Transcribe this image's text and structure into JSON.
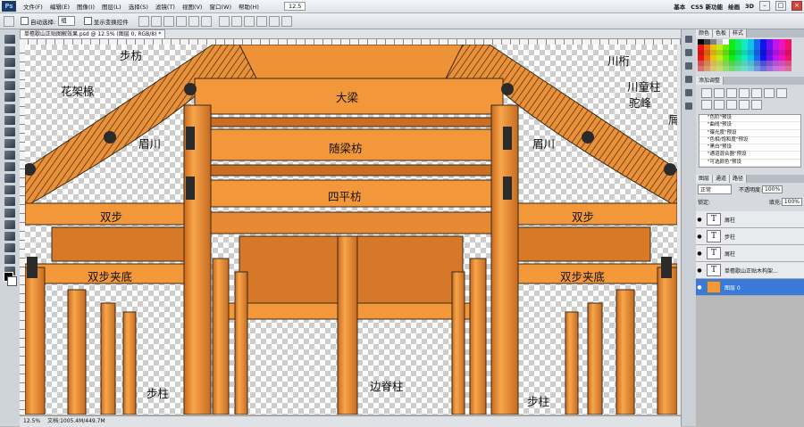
{
  "app": {
    "logo": "Ps"
  },
  "menu": [
    "文件(F)",
    "编辑(E)",
    "图像(I)",
    "图层(L)",
    "选择(S)",
    "滤镜(T)",
    "视图(V)",
    "窗口(W)",
    "帮助(H)"
  ],
  "menu_right": {
    "zoom": "12.5",
    "workspace1": "基本",
    "workspace2": "CS5 新功能",
    "workspace3": "绘画",
    "workspace4": "3D"
  },
  "options": {
    "auto_select_label": "自动选择:",
    "auto_select_value": "组",
    "show_transform_label": "显示变换控件"
  },
  "document": {
    "tab_title": "单檐歇山正贴图解效果.psd @ 12.5% (图层 0, RGB/8) *"
  },
  "canvas_labels": {
    "bufang": "步枋",
    "huajiachuan": "花架椽",
    "chuanheng": "川桁",
    "chuantongzhu": "川童柱",
    "tuofeng": "驼峰",
    "dali": "大梁",
    "meichuan_l": "眉川",
    "meichuan_r": "眉川",
    "suiliangfang": "随梁枋",
    "sipingfang": "四平枋",
    "shuangbu_l": "双步",
    "shuangbu_r": "双步",
    "shuangbujiadi_l": "双步夹底",
    "shuangbujiadi_r": "双步夹底",
    "buzhu_l": "步柱",
    "bianjizhu": "边脊柱",
    "buzhu_r": "步柱",
    "edge_mark": "屑"
  },
  "status": {
    "zoom": "12.5%",
    "doc": "文档:1005.4M/449.7M"
  },
  "panels": {
    "swatches_tabs": [
      "颜色",
      "色板",
      "样式"
    ],
    "adjust_title": "添加调整",
    "presets": [
      "\"色阶\"预设",
      "\"曲线\"预设",
      "\"曝光度\"预设",
      "\"色相/饱和度\"预设",
      "\"黑白\"预设",
      "\"通道混合器\"预设",
      "\"可选颜色\"预设"
    ],
    "layers_tabs": [
      "图层",
      "通道",
      "路径"
    ],
    "blend_mode": "正常",
    "opacity_label": "不透明度:",
    "opacity": "100%",
    "lock_label": "锁定:",
    "fill_label": "填充:",
    "fill": "100%",
    "layers": [
      {
        "name": "屑柱",
        "kind": "T",
        "selected": false
      },
      {
        "name": "步柱",
        "kind": "T",
        "selected": false
      },
      {
        "name": "屑柱",
        "kind": "T",
        "selected": false
      },
      {
        "name": "单檐歇山正贴木构架...",
        "kind": "T",
        "selected": false
      },
      {
        "name": "图层 0",
        "kind": "img",
        "selected": true
      }
    ]
  },
  "colors": {
    "wood": "#F2973A",
    "wood_dark": "#B85F18",
    "wood_line": "#3a2a1a",
    "highlight": "#3979d8"
  }
}
